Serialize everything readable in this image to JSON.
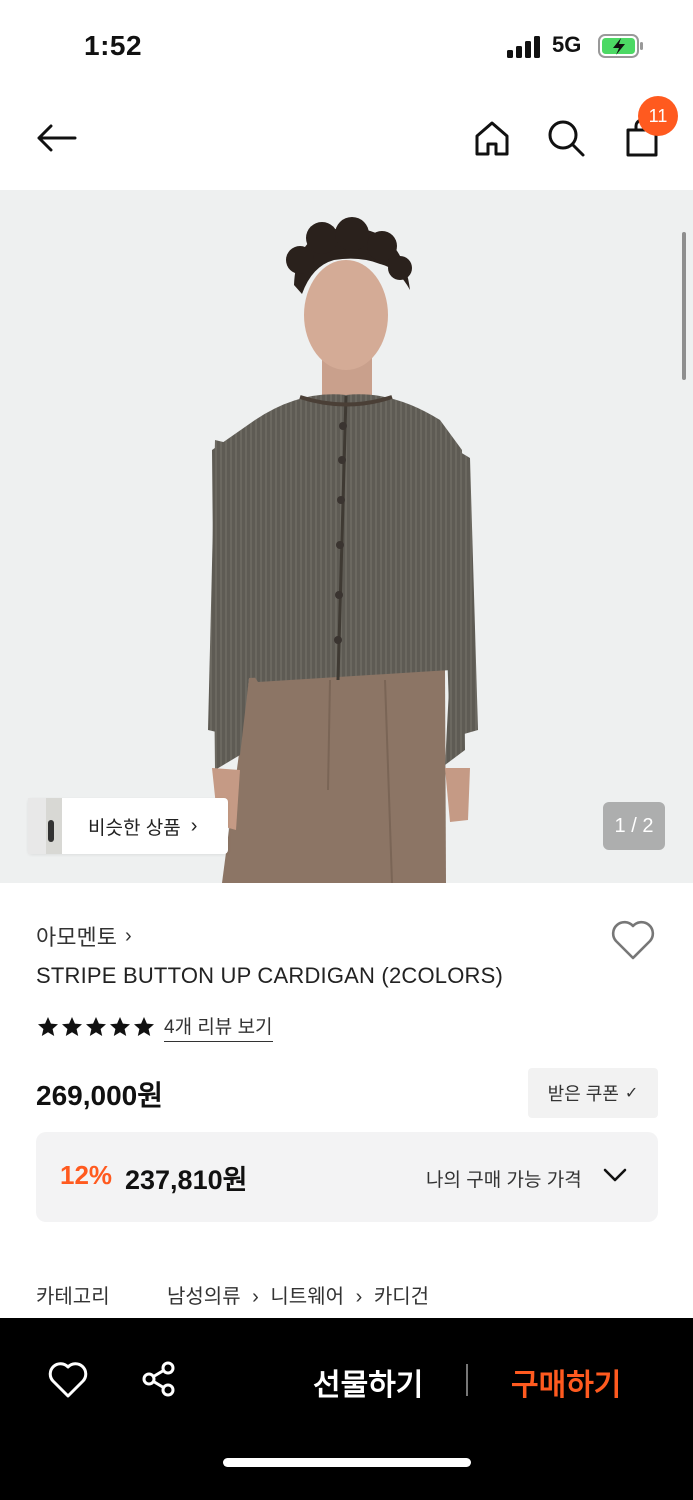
{
  "status": {
    "time": "1:52",
    "network": "5G"
  },
  "nav": {
    "cart_count": "11"
  },
  "image": {
    "similar_label": "비슷한 상품",
    "page_indicator": "1 / 2"
  },
  "product": {
    "brand": "아모멘토",
    "name": "STRIPE BUTTON UP CARDIGAN (2COLORS)",
    "rating_stars": 5,
    "review_link": "4개 리뷰 보기",
    "price": "269,000원",
    "coupon_label": "받은 쿠폰",
    "discount_rate": "12%",
    "sale_price": "237,810원",
    "my_price_label": "나의 구매 가능 가격"
  },
  "category": {
    "label": "카테고리",
    "path": [
      "남성의류",
      "니트웨어",
      "카디건"
    ]
  },
  "bottom_bar": {
    "gift_label": "선물하기",
    "buy_label": "구매하기"
  },
  "colors": {
    "accent": "#ff5a1f",
    "bottom_bar_bg": "#000000",
    "image_bg": "#eef0f0"
  },
  "icons": [
    "back-arrow-icon",
    "home-icon",
    "search-icon",
    "bag-icon",
    "heart-icon",
    "star-icon",
    "chevron-down-icon",
    "share-icon"
  ]
}
